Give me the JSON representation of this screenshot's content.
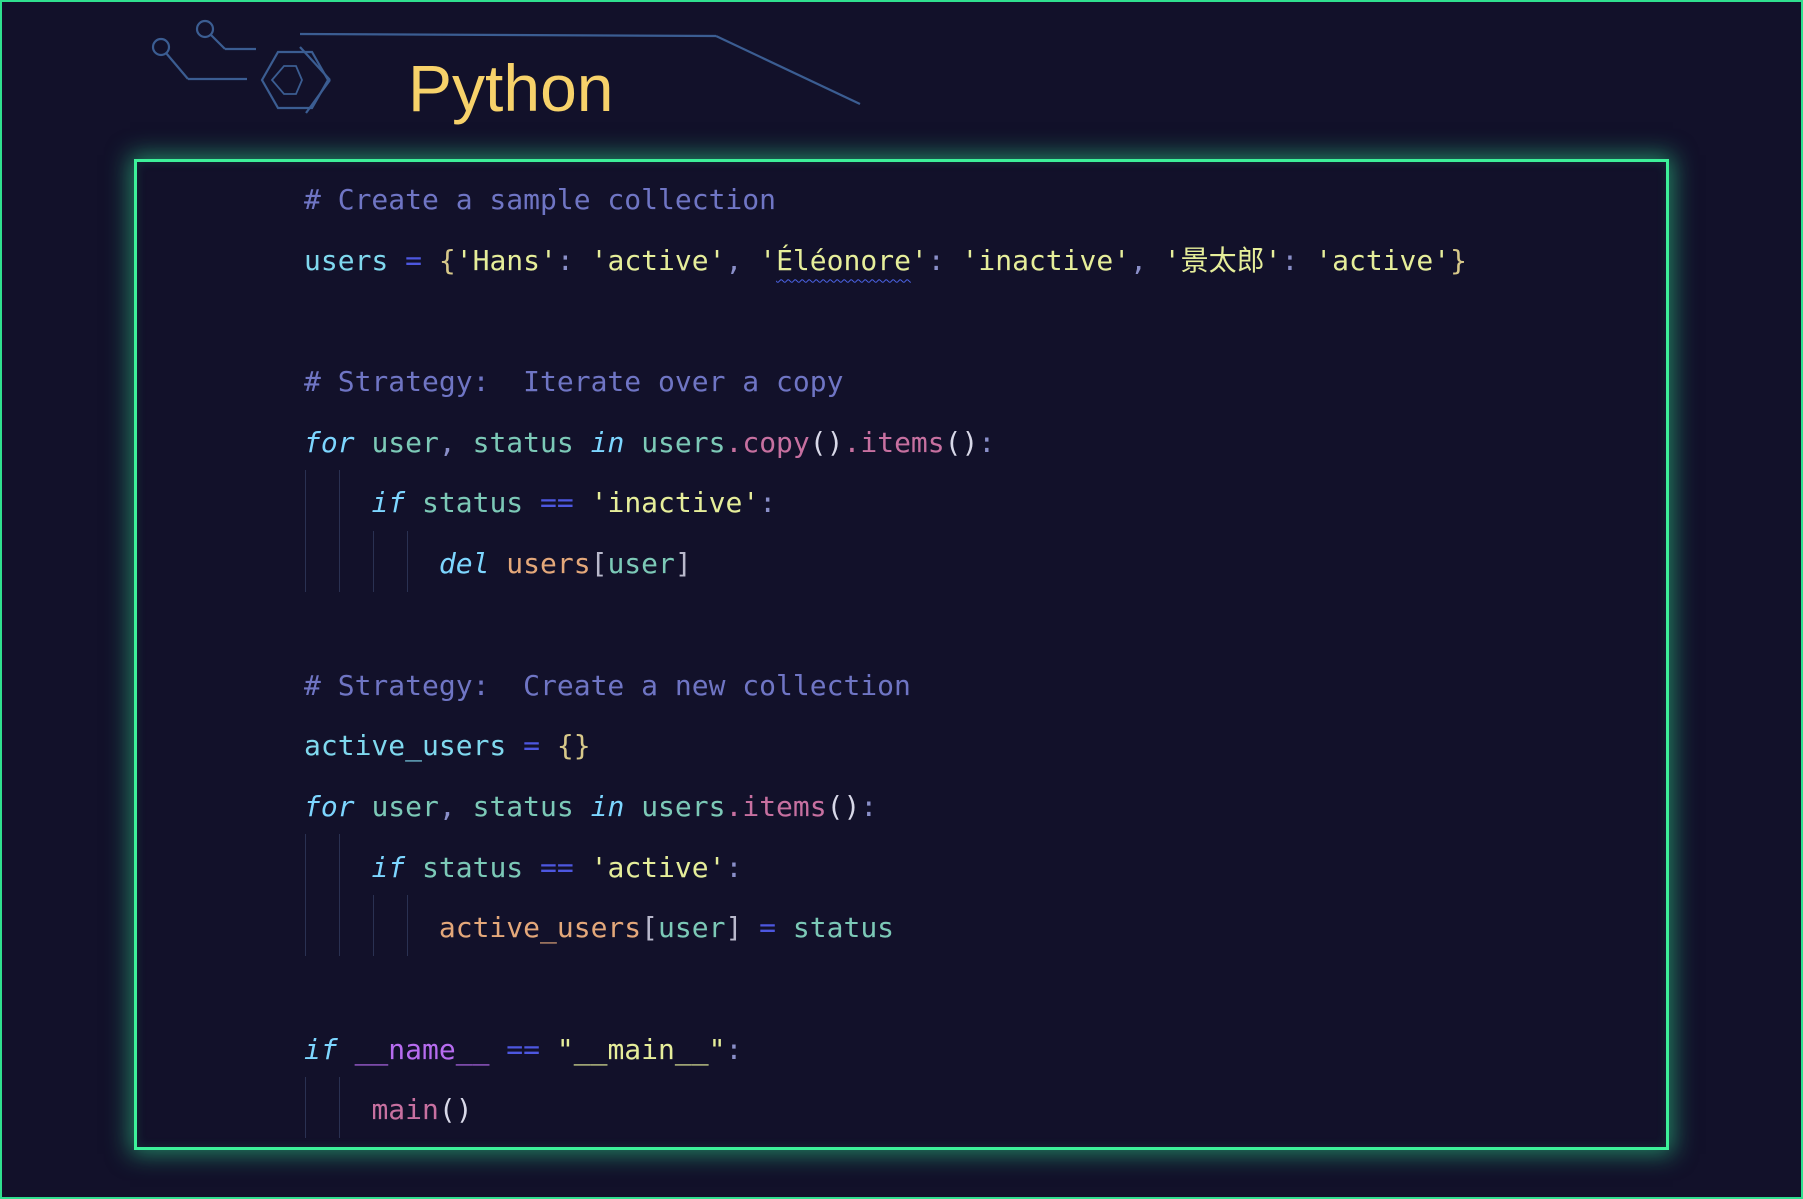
{
  "header": {
    "title": "Python"
  },
  "colors": {
    "border": "#2fe08f",
    "title": "#f7d26a",
    "background": "#12112a",
    "comment": "#6f75c4",
    "string": "#e6ee9a",
    "keyword": "#7dd6ff"
  },
  "code": {
    "language": "Python",
    "lines": [
      "# Create a sample collection",
      "users = {'Hans': 'active', 'Éléonore': 'inactive', '景太郎': 'active'}",
      "",
      "# Strategy:  Iterate over a copy",
      "for user, status in users.copy().items():",
      "    if status == 'inactive':",
      "        del users[user]",
      "",
      "# Strategy:  Create a new collection",
      "active_users = {}",
      "for user, status in users.items():",
      "    if status == 'active':",
      "        active_users[user] = status",
      "",
      "if __name__ == \"__main__\":",
      "    main()"
    ]
  }
}
